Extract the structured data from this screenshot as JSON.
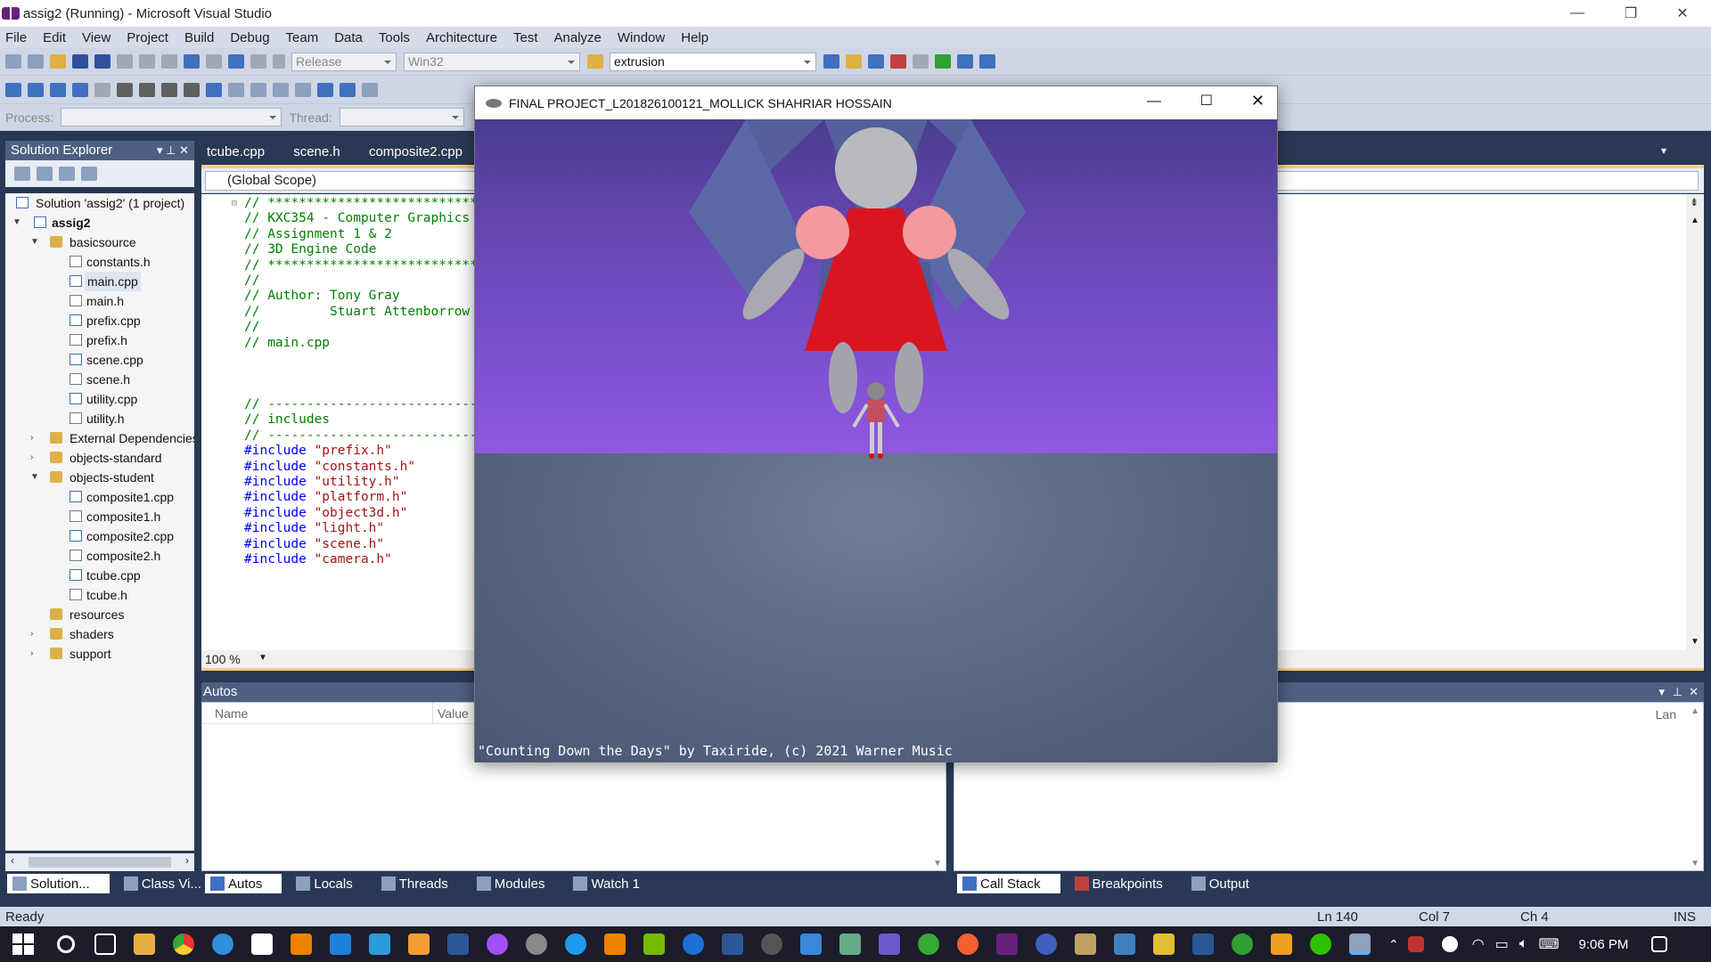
{
  "window": {
    "title": "assig2 (Running) - Microsoft Visual Studio"
  },
  "menu": [
    "File",
    "Edit",
    "View",
    "Project",
    "Build",
    "Debug",
    "Team",
    "Data",
    "Tools",
    "Architecture",
    "Test",
    "Analyze",
    "Window",
    "Help"
  ],
  "toolbar": {
    "config": "Release",
    "platform": "Win32",
    "find": "extrusion",
    "process_label": "Process:",
    "thread_label": "Thread:"
  },
  "solution_explorer": {
    "title": "Solution Explorer",
    "items": [
      {
        "label": "Solution 'assig2' (1 project)"
      },
      {
        "label": "assig2"
      },
      {
        "label": "basicsource"
      },
      {
        "label": "constants.h"
      },
      {
        "label": "main.cpp"
      },
      {
        "label": "main.h"
      },
      {
        "label": "prefix.cpp"
      },
      {
        "label": "prefix.h"
      },
      {
        "label": "scene.cpp"
      },
      {
        "label": "scene.h"
      },
      {
        "label": "utility.cpp"
      },
      {
        "label": "utility.h"
      },
      {
        "label": "External Dependencies"
      },
      {
        "label": "objects-standard"
      },
      {
        "label": "objects-student"
      },
      {
        "label": "composite1.cpp"
      },
      {
        "label": "composite1.h"
      },
      {
        "label": "composite2.cpp"
      },
      {
        "label": "composite2.h"
      },
      {
        "label": "tcube.cpp"
      },
      {
        "label": "tcube.h"
      },
      {
        "label": "resources"
      },
      {
        "label": "shaders"
      },
      {
        "label": "support"
      }
    ],
    "bottom_tabs": [
      "Solution...",
      "Class Vi..."
    ]
  },
  "editor": {
    "tabs": [
      "tcube.cpp",
      "scene.h",
      "composite2.cpp"
    ],
    "scope": "(Global Scope)",
    "zoom": "100 %",
    "lines": [
      {
        "t": "// ****************************",
        "c": "cmt"
      },
      {
        "t": "// KXC354 - Computer Graphics",
        "c": "cmt"
      },
      {
        "t": "// Assignment 1 & 2",
        "c": "cmt"
      },
      {
        "t": "// 3D Engine Code",
        "c": "cmt"
      },
      {
        "t": "// ****************************",
        "c": "cmt"
      },
      {
        "t": "//",
        "c": "cmt"
      },
      {
        "t": "// Author: Tony Gray",
        "c": "cmt"
      },
      {
        "t": "//         Stuart Attenborrow",
        "c": "cmt"
      },
      {
        "t": "//",
        "c": "cmt"
      },
      {
        "t": "// main.cpp",
        "c": "cmt"
      },
      {
        "t": "",
        "c": "cmt"
      },
      {
        "t": "",
        "c": "cmt"
      },
      {
        "t": "",
        "c": "cmt"
      },
      {
        "t": "// ----------------------------",
        "c": "cmt"
      },
      {
        "t": "// includes",
        "c": "cmt"
      },
      {
        "t": "// ----------------------------",
        "c": "cmt"
      },
      {
        "k": "#include",
        "s": "\"prefix.h\""
      },
      {
        "k": "#include",
        "s": "\"constants.h\""
      },
      {
        "k": "#include",
        "s": "\"utility.h\""
      },
      {
        "k": "#include",
        "s": "\"platform.h\""
      },
      {
        "k": "#include",
        "s": "\"object3d.h\""
      },
      {
        "k": "#include",
        "s": "\"light.h\""
      },
      {
        "k": "#include",
        "s": "\"scene.h\""
      },
      {
        "k": "#include",
        "s": "\"camera.h\""
      }
    ]
  },
  "autos": {
    "title": "Autos",
    "col_name": "Name",
    "col_value": "Value",
    "col_lang": "Lan"
  },
  "debug_tabs_left": [
    "Autos",
    "Locals",
    "Threads",
    "Modules",
    "Watch 1"
  ],
  "debug_tabs_right": [
    "Call Stack",
    "Breakpoints",
    "Output"
  ],
  "status": {
    "ready": "Ready",
    "ln": "Ln 140",
    "col": "Col 7",
    "ch": "Ch 4",
    "ins": "INS"
  },
  "clock": "9:06 PM",
  "game": {
    "title": "FINAL PROJECT_L201826100121_MOLLICK SHAHRIAR HOSSAIN",
    "caption": "\"Counting Down the Days\" by Taxiride, (c) 2021 Warner Music"
  }
}
